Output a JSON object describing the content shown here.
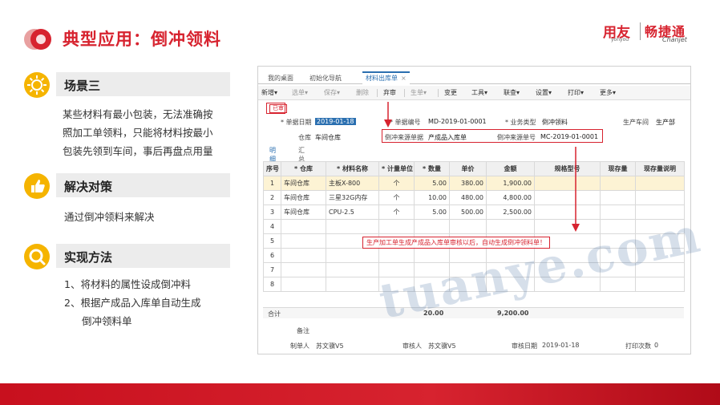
{
  "slide": {
    "title": "典型应用：倒冲领料",
    "logo_yonyou": "用友",
    "logo_yonyou_sub": "yonyou",
    "logo_chanjet": "畅捷通",
    "logo_chanjet_sub": "Chanjet"
  },
  "sections": [
    {
      "heading": "场景三",
      "lines": [
        "某些材料有最小包装，无法准确按",
        "照加工单领料，只能将材料按最小",
        "包装先领到车间，事后再盘点用量"
      ]
    },
    {
      "heading": "解决对策",
      "lines": [
        "通过倒冲领料来解决"
      ]
    },
    {
      "heading": "实现方法",
      "lines": [
        "1、将材料的属性设成倒冲料",
        "2、根据产成品入库单自动生成",
        "倒冲领料单"
      ]
    }
  ],
  "app": {
    "tabs": [
      "我的桌面",
      "初始化导航",
      "材料出库单"
    ],
    "tab_close": "×",
    "toolbar": [
      "新增▾",
      "选单▾",
      "保存▾",
      "删除",
      "弃审",
      "生单▾",
      "变更",
      "工具▾",
      "联查▾",
      "设置▾",
      "打印▾",
      "更多▾"
    ],
    "status": "已审",
    "fields": {
      "date_label": "* 单据日期",
      "date_value": "2019-01-18",
      "code_label": "* 单据编号",
      "code_value": "MD-2019-01-0001",
      "biz_label": "* 业务类型",
      "biz_value": "倒冲领料",
      "workshop_label": "生产车间",
      "workshop_value": "生产部",
      "wh_label": "仓库",
      "wh_value": "车间仓库",
      "src_type_label": "倒冲来源单据",
      "src_type_value": "产成品入库单",
      "src_no_label": "倒冲来源单号",
      "src_no_value": "MC-2019-01-0001"
    },
    "sub_tabs": [
      "明细",
      "汇总"
    ],
    "columns": [
      "序号",
      "* 仓库",
      "* 材料名称",
      "* 计量单位",
      "* 数量",
      "单价",
      "金额",
      "规格型号",
      "现存量",
      "现存量说明"
    ],
    "rows": [
      [
        "1",
        "车间仓库",
        "主板X-800",
        "个",
        "5.00",
        "380.00",
        "1,900.00",
        "",
        "",
        ""
      ],
      [
        "2",
        "车间仓库",
        "三星32G内存",
        "个",
        "10.00",
        "480.00",
        "4,800.00",
        "",
        "",
        ""
      ],
      [
        "3",
        "车间仓库",
        "CPU-2.5",
        "个",
        "5.00",
        "500.00",
        "2,500.00",
        "",
        "",
        ""
      ],
      [
        "4",
        "",
        "",
        "",
        "",
        "",
        "",
        "",
        "",
        ""
      ],
      [
        "5",
        "",
        "",
        "",
        "",
        "",
        "",
        "",
        "",
        ""
      ],
      [
        "6",
        "",
        "",
        "",
        "",
        "",
        "",
        "",
        "",
        ""
      ],
      [
        "7",
        "",
        "",
        "",
        "",
        "",
        "",
        "",
        "",
        ""
      ],
      [
        "8",
        "",
        "",
        "",
        "",
        "",
        "",
        "",
        "",
        ""
      ]
    ],
    "total": {
      "label": "合计",
      "qty": "20.00",
      "amount": "9,200.00"
    },
    "annotation": "生产加工单生成产成品入库单审核以后，自动生成倒冲领料单！",
    "footer": {
      "remark_label": "备注",
      "maker_label": "制单人",
      "maker_value": "苏文骥V5",
      "auditor_label": "审核人",
      "auditor_value": "苏文骥V5",
      "audit_date_label": "审核日期",
      "audit_date_value": "2019-01-18",
      "print_label": "打印次数",
      "print_value": "0"
    }
  },
  "watermark": "tuanye.com",
  "colors": {
    "brand_red": "#d7232f",
    "icon_yellow": "#f5b400",
    "link_blue": "#2a6fb0"
  }
}
